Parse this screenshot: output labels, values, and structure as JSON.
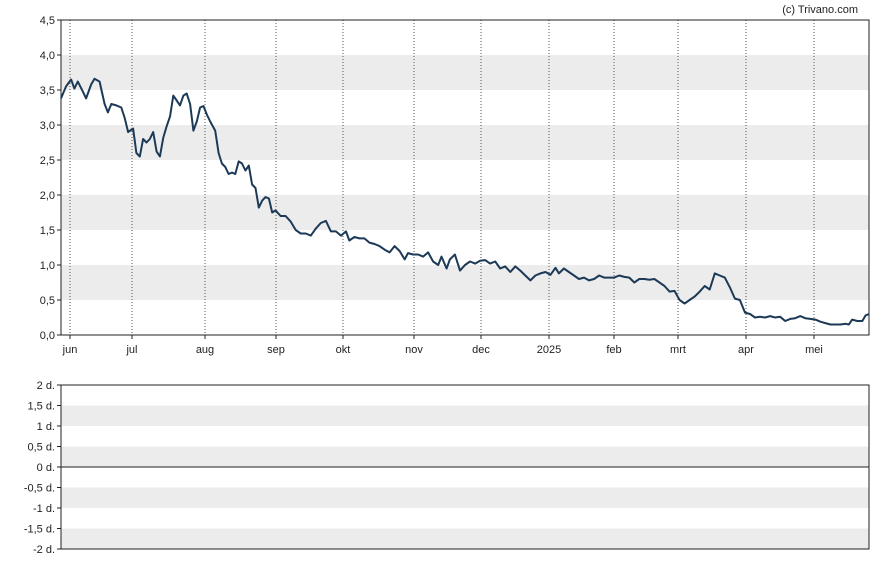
{
  "credit": "(c) Trivano.com",
  "colors": {
    "line": "#1c3a57",
    "band": "#ececec",
    "axis": "#222222",
    "grid": "#555555",
    "zero": "#222222"
  },
  "chart_data": [
    {
      "type": "line",
      "title": "",
      "xlabel": "",
      "ylabel": "",
      "ylim": [
        0,
        4.5
      ],
      "y_ticks": [
        "0,0",
        "0,5",
        "1,0",
        "1,5",
        "2,0",
        "2,5",
        "3,0",
        "3,5",
        "4,0",
        "4,5"
      ],
      "x_ticks": [
        "jun",
        "jul",
        "aug",
        "sep",
        "okt",
        "nov",
        "dec",
        "2025",
        "feb",
        "mrt",
        "apr",
        "mei"
      ],
      "grid": "vertical dotted at month starts, alternating horizontal bands",
      "series": [
        {
          "values": [
            [
              0,
              3.38
            ],
            [
              3,
              3.55
            ],
            [
              6,
              3.65
            ],
            [
              8,
              3.52
            ],
            [
              10,
              3.62
            ],
            [
              13,
              3.48
            ],
            [
              15,
              3.38
            ],
            [
              18,
              3.58
            ],
            [
              20,
              3.66
            ],
            [
              23,
              3.62
            ],
            [
              26,
              3.3
            ],
            [
              28,
              3.18
            ],
            [
              30,
              3.3
            ],
            [
              33,
              3.28
            ],
            [
              36,
              3.25
            ],
            [
              38,
              3.1
            ],
            [
              40,
              2.9
            ],
            [
              43,
              2.95
            ],
            [
              45,
              2.6
            ],
            [
              47,
              2.55
            ],
            [
              49,
              2.8
            ],
            [
              51,
              2.75
            ],
            [
              53,
              2.8
            ],
            [
              55,
              2.9
            ],
            [
              57,
              2.62
            ],
            [
              59,
              2.55
            ],
            [
              61,
              2.82
            ],
            [
              63,
              2.98
            ],
            [
              65,
              3.12
            ],
            [
              67,
              3.42
            ],
            [
              69,
              3.35
            ],
            [
              71,
              3.28
            ],
            [
              73,
              3.42
            ],
            [
              75,
              3.45
            ],
            [
              77,
              3.3
            ],
            [
              79,
              2.92
            ],
            [
              81,
              3.05
            ],
            [
              83,
              3.25
            ],
            [
              85,
              3.27
            ],
            [
              87,
              3.15
            ],
            [
              89,
              3.05
            ],
            [
              92,
              2.92
            ],
            [
              94,
              2.6
            ],
            [
              96,
              2.45
            ],
            [
              98,
              2.4
            ],
            [
              100,
              2.3
            ],
            [
              102,
              2.32
            ],
            [
              104,
              2.3
            ],
            [
              106,
              2.48
            ],
            [
              108,
              2.45
            ],
            [
              110,
              2.35
            ],
            [
              112,
              2.42
            ],
            [
              114,
              2.15
            ],
            [
              116,
              2.1
            ],
            [
              118,
              1.82
            ],
            [
              120,
              1.92
            ],
            [
              122,
              1.97
            ],
            [
              124,
              1.95
            ],
            [
              126,
              1.75
            ],
            [
              128,
              1.78
            ],
            [
              131,
              1.7
            ],
            [
              134,
              1.7
            ],
            [
              137,
              1.62
            ],
            [
              140,
              1.5
            ],
            [
              143,
              1.45
            ],
            [
              146,
              1.45
            ],
            [
              149,
              1.42
            ],
            [
              152,
              1.52
            ],
            [
              155,
              1.6
            ],
            [
              158,
              1.63
            ],
            [
              161,
              1.48
            ],
            [
              164,
              1.48
            ],
            [
              167,
              1.42
            ],
            [
              170,
              1.48
            ],
            [
              172,
              1.35
            ],
            [
              175,
              1.4
            ],
            [
              178,
              1.38
            ],
            [
              181,
              1.38
            ],
            [
              184,
              1.32
            ],
            [
              187,
              1.3
            ],
            [
              190,
              1.27
            ],
            [
              193,
              1.22
            ],
            [
              196,
              1.18
            ],
            [
              199,
              1.27
            ],
            [
              202,
              1.2
            ],
            [
              205,
              1.08
            ],
            [
              207,
              1.17
            ],
            [
              210,
              1.15
            ],
            [
              213,
              1.15
            ],
            [
              216,
              1.12
            ],
            [
              219,
              1.18
            ],
            [
              222,
              1.05
            ],
            [
              225,
              1.0
            ],
            [
              227,
              1.12
            ],
            [
              230,
              0.95
            ],
            [
              232,
              1.08
            ],
            [
              235,
              1.15
            ],
            [
              238,
              0.92
            ],
            [
              241,
              1.0
            ],
            [
              244,
              1.05
            ],
            [
              247,
              1.02
            ],
            [
              250,
              1.06
            ],
            [
              253,
              1.07
            ],
            [
              256,
              1.02
            ],
            [
              259,
              1.05
            ],
            [
              262,
              0.95
            ],
            [
              265,
              0.98
            ],
            [
              268,
              0.9
            ],
            [
              271,
              0.98
            ],
            [
              274,
              0.92
            ],
            [
              277,
              0.85
            ],
            [
              280,
              0.78
            ],
            [
              283,
              0.85
            ],
            [
              286,
              0.88
            ],
            [
              289,
              0.9
            ],
            [
              292,
              0.86
            ],
            [
              295,
              0.96
            ],
            [
              297,
              0.88
            ],
            [
              300,
              0.95
            ],
            [
              303,
              0.9
            ],
            [
              306,
              0.85
            ],
            [
              309,
              0.8
            ],
            [
              312,
              0.82
            ],
            [
              315,
              0.78
            ],
            [
              318,
              0.8
            ],
            [
              321,
              0.85
            ],
            [
              324,
              0.82
            ],
            [
              327,
              0.82
            ],
            [
              330,
              0.82
            ],
            [
              333,
              0.85
            ],
            [
              336,
              0.83
            ],
            [
              339,
              0.82
            ],
            [
              342,
              0.75
            ],
            [
              345,
              0.8
            ],
            [
              348,
              0.8
            ],
            [
              351,
              0.79
            ],
            [
              354,
              0.8
            ],
            [
              357,
              0.75
            ],
            [
              360,
              0.7
            ],
            [
              363,
              0.62
            ],
            [
              366,
              0.63
            ],
            [
              369,
              0.5
            ],
            [
              372,
              0.45
            ],
            [
              375,
              0.5
            ],
            [
              378,
              0.55
            ],
            [
              381,
              0.62
            ],
            [
              384,
              0.7
            ],
            [
              387,
              0.65
            ],
            [
              390,
              0.88
            ],
            [
              393,
              0.85
            ],
            [
              396,
              0.82
            ],
            [
              399,
              0.68
            ],
            [
              402,
              0.52
            ],
            [
              405,
              0.5
            ],
            [
              408,
              0.32
            ],
            [
              411,
              0.3
            ],
            [
              414,
              0.25
            ],
            [
              417,
              0.26
            ],
            [
              420,
              0.25
            ],
            [
              423,
              0.27
            ],
            [
              426,
              0.25
            ],
            [
              429,
              0.26
            ],
            [
              432,
              0.2
            ],
            [
              435,
              0.23
            ],
            [
              438,
              0.24
            ],
            [
              441,
              0.27
            ],
            [
              444,
              0.24
            ],
            [
              447,
              0.23
            ],
            [
              450,
              0.22
            ],
            [
              453,
              0.19
            ],
            [
              456,
              0.17
            ],
            [
              459,
              0.15
            ],
            [
              462,
              0.15
            ],
            [
              465,
              0.15
            ],
            [
              468,
              0.16
            ],
            [
              470,
              0.15
            ],
            [
              472,
              0.22
            ],
            [
              475,
              0.2
            ],
            [
              478,
              0.2
            ],
            [
              480,
              0.28
            ],
            [
              482,
              0.3
            ]
          ]
        }
      ]
    },
    {
      "type": "line",
      "title": "",
      "ylim": [
        -2,
        2
      ],
      "y_ticks": [
        "2 d.",
        "1,5 d.",
        "1 d.",
        "0,5 d.",
        "0 d.",
        "-0,5 d.",
        "-1 d.",
        "-1,5 d.",
        "-2 d."
      ],
      "grid": "alternating horizontal bands, solid zero line",
      "series": []
    }
  ]
}
